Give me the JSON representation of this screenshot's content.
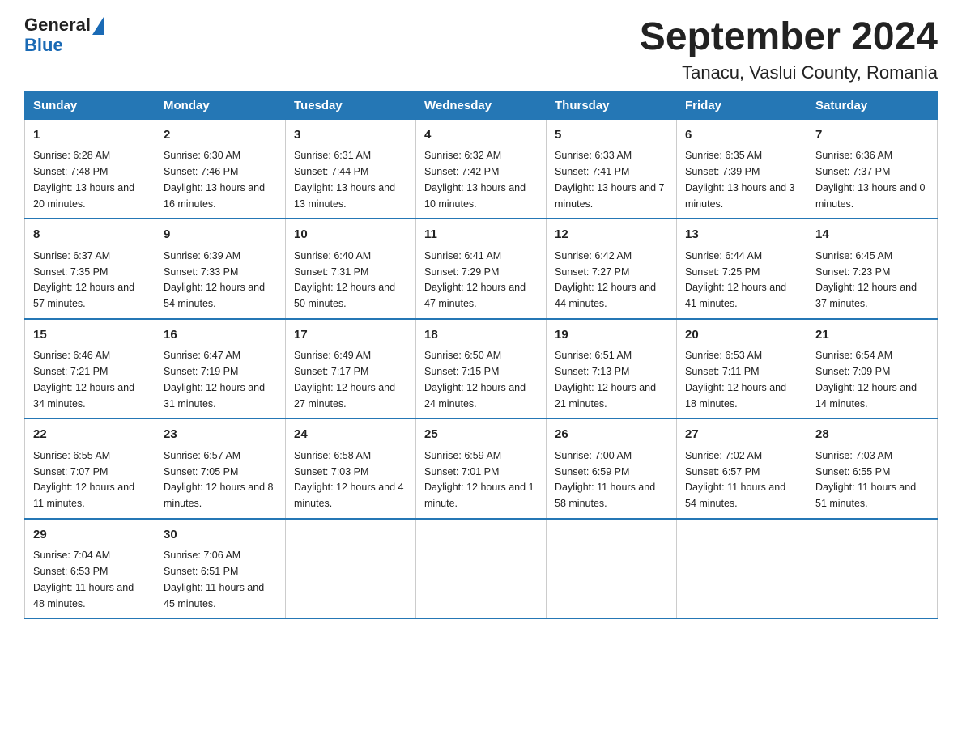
{
  "logo": {
    "text_general": "General",
    "triangle": "▲",
    "text_blue": "Blue"
  },
  "title": "September 2024",
  "subtitle": "Tanacu, Vaslui County, Romania",
  "weekdays": [
    "Sunday",
    "Monday",
    "Tuesday",
    "Wednesday",
    "Thursday",
    "Friday",
    "Saturday"
  ],
  "weeks": [
    [
      {
        "day": "1",
        "sunrise": "6:28 AM",
        "sunset": "7:48 PM",
        "daylight": "13 hours and 20 minutes."
      },
      {
        "day": "2",
        "sunrise": "6:30 AM",
        "sunset": "7:46 PM",
        "daylight": "13 hours and 16 minutes."
      },
      {
        "day": "3",
        "sunrise": "6:31 AM",
        "sunset": "7:44 PM",
        "daylight": "13 hours and 13 minutes."
      },
      {
        "day": "4",
        "sunrise": "6:32 AM",
        "sunset": "7:42 PM",
        "daylight": "13 hours and 10 minutes."
      },
      {
        "day": "5",
        "sunrise": "6:33 AM",
        "sunset": "7:41 PM",
        "daylight": "13 hours and 7 minutes."
      },
      {
        "day": "6",
        "sunrise": "6:35 AM",
        "sunset": "7:39 PM",
        "daylight": "13 hours and 3 minutes."
      },
      {
        "day": "7",
        "sunrise": "6:36 AM",
        "sunset": "7:37 PM",
        "daylight": "13 hours and 0 minutes."
      }
    ],
    [
      {
        "day": "8",
        "sunrise": "6:37 AM",
        "sunset": "7:35 PM",
        "daylight": "12 hours and 57 minutes."
      },
      {
        "day": "9",
        "sunrise": "6:39 AM",
        "sunset": "7:33 PM",
        "daylight": "12 hours and 54 minutes."
      },
      {
        "day": "10",
        "sunrise": "6:40 AM",
        "sunset": "7:31 PM",
        "daylight": "12 hours and 50 minutes."
      },
      {
        "day": "11",
        "sunrise": "6:41 AM",
        "sunset": "7:29 PM",
        "daylight": "12 hours and 47 minutes."
      },
      {
        "day": "12",
        "sunrise": "6:42 AM",
        "sunset": "7:27 PM",
        "daylight": "12 hours and 44 minutes."
      },
      {
        "day": "13",
        "sunrise": "6:44 AM",
        "sunset": "7:25 PM",
        "daylight": "12 hours and 41 minutes."
      },
      {
        "day": "14",
        "sunrise": "6:45 AM",
        "sunset": "7:23 PM",
        "daylight": "12 hours and 37 minutes."
      }
    ],
    [
      {
        "day": "15",
        "sunrise": "6:46 AM",
        "sunset": "7:21 PM",
        "daylight": "12 hours and 34 minutes."
      },
      {
        "day": "16",
        "sunrise": "6:47 AM",
        "sunset": "7:19 PM",
        "daylight": "12 hours and 31 minutes."
      },
      {
        "day": "17",
        "sunrise": "6:49 AM",
        "sunset": "7:17 PM",
        "daylight": "12 hours and 27 minutes."
      },
      {
        "day": "18",
        "sunrise": "6:50 AM",
        "sunset": "7:15 PM",
        "daylight": "12 hours and 24 minutes."
      },
      {
        "day": "19",
        "sunrise": "6:51 AM",
        "sunset": "7:13 PM",
        "daylight": "12 hours and 21 minutes."
      },
      {
        "day": "20",
        "sunrise": "6:53 AM",
        "sunset": "7:11 PM",
        "daylight": "12 hours and 18 minutes."
      },
      {
        "day": "21",
        "sunrise": "6:54 AM",
        "sunset": "7:09 PM",
        "daylight": "12 hours and 14 minutes."
      }
    ],
    [
      {
        "day": "22",
        "sunrise": "6:55 AM",
        "sunset": "7:07 PM",
        "daylight": "12 hours and 11 minutes."
      },
      {
        "day": "23",
        "sunrise": "6:57 AM",
        "sunset": "7:05 PM",
        "daylight": "12 hours and 8 minutes."
      },
      {
        "day": "24",
        "sunrise": "6:58 AM",
        "sunset": "7:03 PM",
        "daylight": "12 hours and 4 minutes."
      },
      {
        "day": "25",
        "sunrise": "6:59 AM",
        "sunset": "7:01 PM",
        "daylight": "12 hours and 1 minute."
      },
      {
        "day": "26",
        "sunrise": "7:00 AM",
        "sunset": "6:59 PM",
        "daylight": "11 hours and 58 minutes."
      },
      {
        "day": "27",
        "sunrise": "7:02 AM",
        "sunset": "6:57 PM",
        "daylight": "11 hours and 54 minutes."
      },
      {
        "day": "28",
        "sunrise": "7:03 AM",
        "sunset": "6:55 PM",
        "daylight": "11 hours and 51 minutes."
      }
    ],
    [
      {
        "day": "29",
        "sunrise": "7:04 AM",
        "sunset": "6:53 PM",
        "daylight": "11 hours and 48 minutes."
      },
      {
        "day": "30",
        "sunrise": "7:06 AM",
        "sunset": "6:51 PM",
        "daylight": "11 hours and 45 minutes."
      },
      null,
      null,
      null,
      null,
      null
    ]
  ]
}
